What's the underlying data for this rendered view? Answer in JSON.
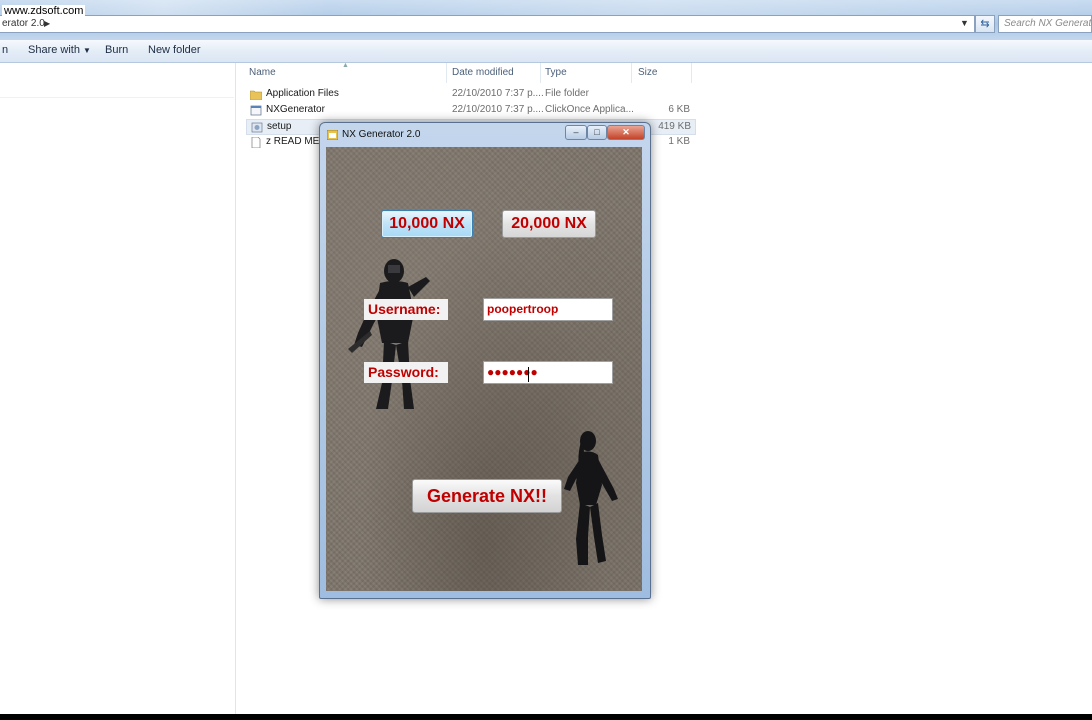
{
  "watermark": "www.zdsoft.com",
  "address_bar": {
    "path": "erator 2.0",
    "search_placeholder": "Search NX Generator"
  },
  "toolbar": {
    "organize_stub": "n",
    "share_with": "Share with",
    "burn": "Burn",
    "new_folder": "New folder"
  },
  "columns": {
    "name": "Name",
    "date_modified": "Date modified",
    "type": "Type",
    "size": "Size"
  },
  "files": [
    {
      "name": "Application Files",
      "date": "22/10/2010 7:37 p....",
      "type": "File folder",
      "size": "",
      "icon": "folder-icon"
    },
    {
      "name": "NXGenerator",
      "date": "22/10/2010 7:37 p....",
      "type": "ClickOnce Applica...",
      "size": "6 KB",
      "icon": "application-icon"
    },
    {
      "name": "setup",
      "date": "",
      "type": "",
      "size": "419 KB",
      "icon": "setup-icon"
    },
    {
      "name": "z READ ME z",
      "date": "",
      "type": "",
      "size": "1 KB",
      "icon": "text-file-icon"
    }
  ],
  "dialog": {
    "title": "NX Generator 2.0",
    "minimize": "–",
    "maximize": "□",
    "close": "✕",
    "btn_10k": "10,000 NX",
    "btn_20k": "20,000 NX",
    "username_label": "Username:",
    "username_value": "poopertroop",
    "password_label": "Password:",
    "password_value": "●●●●●●●",
    "generate": "Generate NX!!"
  },
  "colors": {
    "accent_red": "#c00000",
    "hover_blue": "#bfe3f8"
  }
}
